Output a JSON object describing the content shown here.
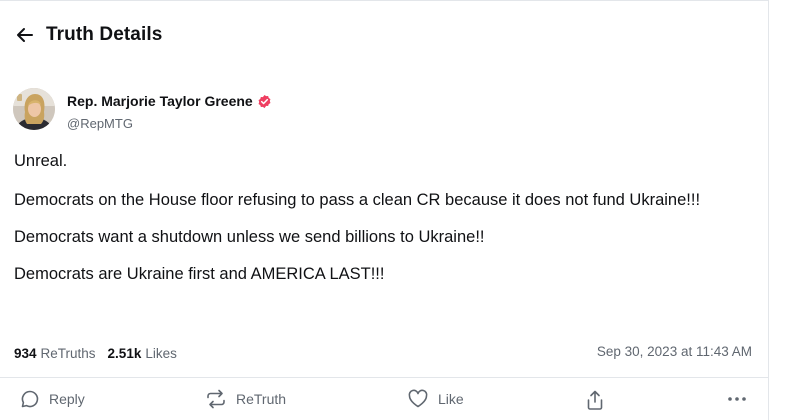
{
  "header": {
    "title": "Truth Details"
  },
  "post": {
    "author": {
      "name": "Rep. Marjorie Taylor Greene",
      "handle": "@RepMTG",
      "verified": true
    },
    "paragraphs": [
      "Unreal.",
      "Democrats on the House floor refusing to pass a clean CR because it does not fund Ukraine!!!",
      "Democrats want a shutdown unless we send billions to Ukraine!!",
      "Democrats are Ukraine first and AMERICA LAST!!!"
    ],
    "stats": {
      "retruths_count": "934",
      "retruths_label": "ReTruths",
      "likes_count": "2.51k",
      "likes_label": "Likes"
    },
    "timestamp": "Sep 30, 2023 at 11:43 AM"
  },
  "actions": {
    "reply_label": "Reply",
    "retruth_label": "ReTruth",
    "like_label": "Like"
  },
  "colors": {
    "text": "#101114",
    "muted": "#606770",
    "border": "#e3e6ea",
    "verified_badge": "#ef3f61"
  }
}
